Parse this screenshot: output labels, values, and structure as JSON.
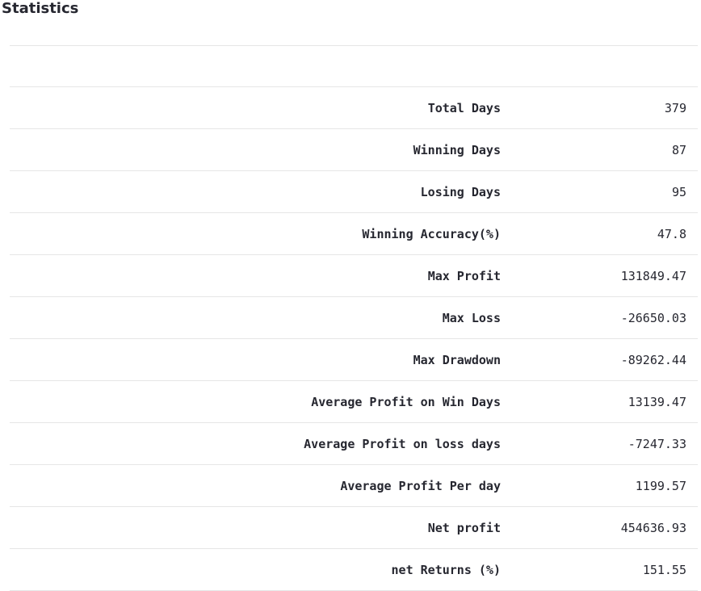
{
  "page": {
    "title": "Statistics"
  },
  "table": {
    "header": [
      "",
      ""
    ],
    "rows": [
      {
        "label": "Total Days",
        "value": "379"
      },
      {
        "label": "Winning Days",
        "value": "87"
      },
      {
        "label": "Losing Days",
        "value": "95"
      },
      {
        "label": "Winning Accuracy(%)",
        "value": "47.8"
      },
      {
        "label": "Max Profit",
        "value": "131849.47"
      },
      {
        "label": "Max Loss",
        "value": "-26650.03"
      },
      {
        "label": "Max Drawdown",
        "value": "-89262.44"
      },
      {
        "label": "Average Profit on Win Days",
        "value": "13139.47"
      },
      {
        "label": "Average Profit on loss days",
        "value": "-7247.33"
      },
      {
        "label": "Average Profit Per day",
        "value": "1199.57"
      },
      {
        "label": "Net profit",
        "value": "454636.93"
      },
      {
        "label": "net Returns (%)",
        "value": "151.55"
      }
    ]
  }
}
